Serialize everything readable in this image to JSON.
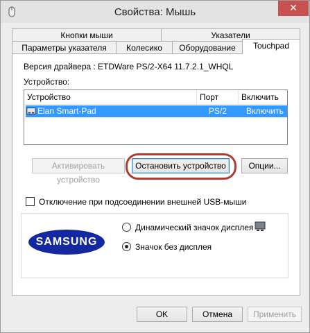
{
  "window": {
    "title": "Свойства: Мышь",
    "close_glyph": "✕"
  },
  "tabs": {
    "row1": [
      "Кнопки мыши",
      "Указатели"
    ],
    "row2": [
      "Параметры указателя",
      "Колесико",
      "Оборудование",
      "Touchpad"
    ],
    "active": "Touchpad"
  },
  "driver": {
    "label": "Версия драйвера :",
    "value": "ETDWare PS/2-X64 11.7.2.1_WHQL"
  },
  "device_section": {
    "label": "Устройство:",
    "columns": [
      "Устройство",
      "Порт",
      "Включить"
    ],
    "rows": [
      {
        "name": "Elan Smart-Pad",
        "port": "PS/2",
        "enable": "Включить",
        "selected": true
      }
    ]
  },
  "buttons": {
    "activate": "Активировать устройство",
    "stop": "Остановить устройство",
    "options": "Опции..."
  },
  "usb_checkbox": {
    "label": "Отключение при подсоединении внешней USB-мыши",
    "checked": false
  },
  "display_group": {
    "logo_text": "SAMSUNG",
    "options": [
      {
        "label": "Динамический значок дисплея",
        "checked": false
      },
      {
        "label": "Значок без дисплея",
        "checked": true
      }
    ]
  },
  "footer": {
    "ok": "OK",
    "cancel": "Отмена",
    "apply": "Применить"
  },
  "colors": {
    "selection": "#3399ff",
    "close_button": "#c75050",
    "highlight_ring": "#b23a2e",
    "samsung_blue": "#1428a0"
  },
  "icons": [
    "mouse-icon",
    "close-icon",
    "device-icon",
    "display-icon"
  ]
}
